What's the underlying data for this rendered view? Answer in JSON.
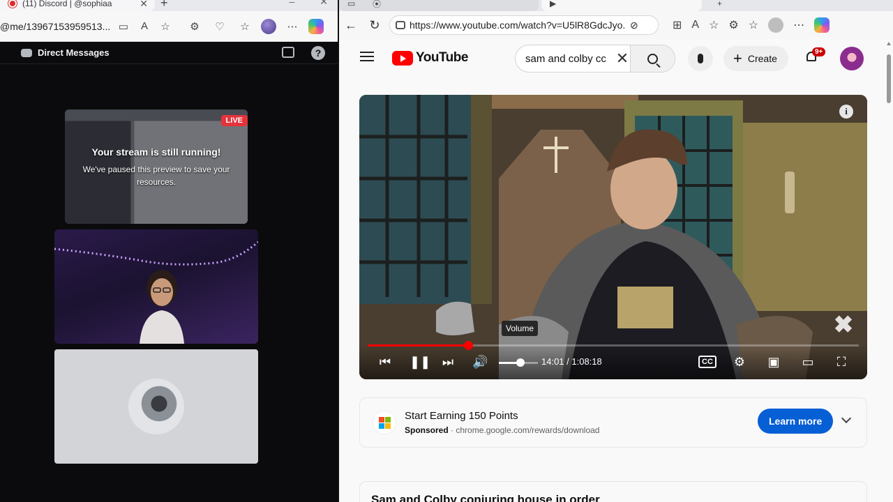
{
  "left_window": {
    "tab_title": "(11) Discord | @sophiaa",
    "url": "@me/13967153959513...",
    "header_title": "Direct Messages",
    "stream_tile": {
      "live_badge": "LIVE",
      "title": "Your stream is still running!",
      "message": "We've paused this preview to save your resources."
    }
  },
  "right_window": {
    "url": "https://www.youtube.com/watch?v=U5lR8GdcJyo...",
    "logo_text": "YouTube",
    "search_query": "sam and colby cc",
    "create_label": "Create",
    "notification_badge": "9+",
    "player": {
      "tooltip": "Volume",
      "current_time": "14:01",
      "duration": "1:08:18",
      "time_display": "14:01 / 1:08:18",
      "progress_fraction": 0.205,
      "volume_fraction": 0.55,
      "info_icon": "info-icon",
      "cc_label": "CC"
    },
    "ad": {
      "title": "Start Earning 150 Points",
      "sponsored_label": "Sponsored",
      "domain": "chrome.google.com/rewards/download",
      "button_label": "Learn more"
    },
    "playlist_title": "Sam and Colby conjuring house in order"
  },
  "colors": {
    "youtube_red": "#ff0000",
    "learn_more_blue": "#065fd4",
    "live_red": "#e4333b",
    "discord_bg": "#0b0b0d"
  }
}
